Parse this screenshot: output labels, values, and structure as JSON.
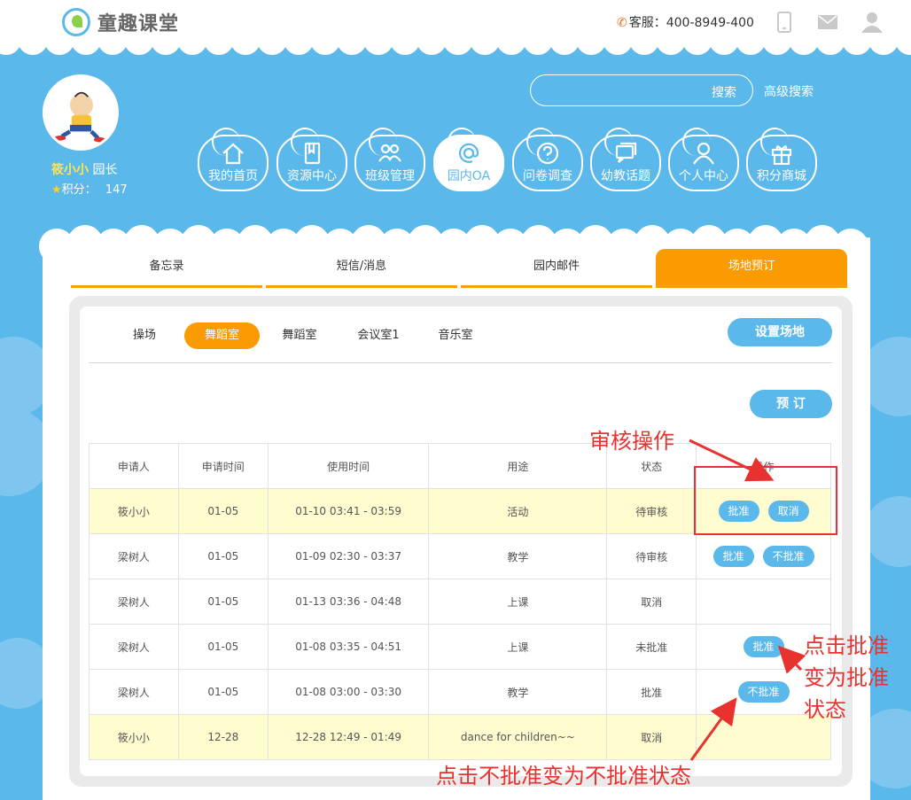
{
  "header": {
    "logo_text": "童趣课堂",
    "service_label": "客服：400-8949-400"
  },
  "profile": {
    "name": "筱小小",
    "role": "园长",
    "points_label": "积分：",
    "points_value": "147"
  },
  "search": {
    "button": "搜索",
    "advanced": "高级搜索"
  },
  "nav": [
    {
      "label": "我的首页",
      "icon": "home-icon"
    },
    {
      "label": "资源中心",
      "icon": "book-icon"
    },
    {
      "label": "班级管理",
      "icon": "group-icon"
    },
    {
      "label": "园内OA",
      "icon": "at-icon"
    },
    {
      "label": "问卷调查",
      "icon": "question-icon"
    },
    {
      "label": "幼教话题",
      "icon": "chat-icon"
    },
    {
      "label": "个人中心",
      "icon": "user-icon"
    },
    {
      "label": "积分商城",
      "icon": "gift-icon"
    }
  ],
  "main_tabs": [
    "备忘录",
    "短信/消息",
    "园内邮件",
    "场地预订"
  ],
  "sub_tabs": [
    "操场",
    "舞蹈室",
    "舞蹈室",
    "会议室1",
    "音乐室"
  ],
  "buttons": {
    "setup": "设置场地",
    "reserve": "预 订"
  },
  "table": {
    "headers": [
      "申请人",
      "申请时间",
      "使用时间",
      "用途",
      "状态",
      "操作"
    ],
    "rows": [
      {
        "applicant": "筱小小",
        "apply": "01-05",
        "use": "01-10 03:41 - 03:59",
        "purpose": "活动",
        "status": "待审核",
        "actions": [
          "批准",
          "取消"
        ]
      },
      {
        "applicant": "梁树人",
        "apply": "01-05",
        "use": "01-09 02:30 - 03:37",
        "purpose": "教学",
        "status": "待审核",
        "actions": [
          "批准",
          "不批准"
        ]
      },
      {
        "applicant": "梁树人",
        "apply": "01-05",
        "use": "01-13 03:36 - 04:48",
        "purpose": "上课",
        "status": "取消",
        "actions": []
      },
      {
        "applicant": "梁树人",
        "apply": "01-05",
        "use": "01-08 03:35 - 04:51",
        "purpose": "上课",
        "status": "未批准",
        "actions": [
          "批准"
        ]
      },
      {
        "applicant": "梁树人",
        "apply": "01-05",
        "use": "01-08 03:00 - 03:30",
        "purpose": "教学",
        "status": "批准",
        "actions": [
          "不批准"
        ]
      },
      {
        "applicant": "筱小小",
        "apply": "12-28",
        "use": "12-28 12:49 - 01:49",
        "purpose": "dance for children~~",
        "status": "取消",
        "actions": []
      }
    ]
  },
  "annotations": {
    "review": "审核操作",
    "approve_1": "点击批准",
    "approve_2": "变为批准",
    "approve_3": "状态",
    "reject": "点击不批准变为不批准状态"
  },
  "colors": {
    "sky": "#5bb8ea",
    "orange": "#fa9b02",
    "highlight_row": "#fffccf",
    "annotation_red": "#e8322f"
  }
}
